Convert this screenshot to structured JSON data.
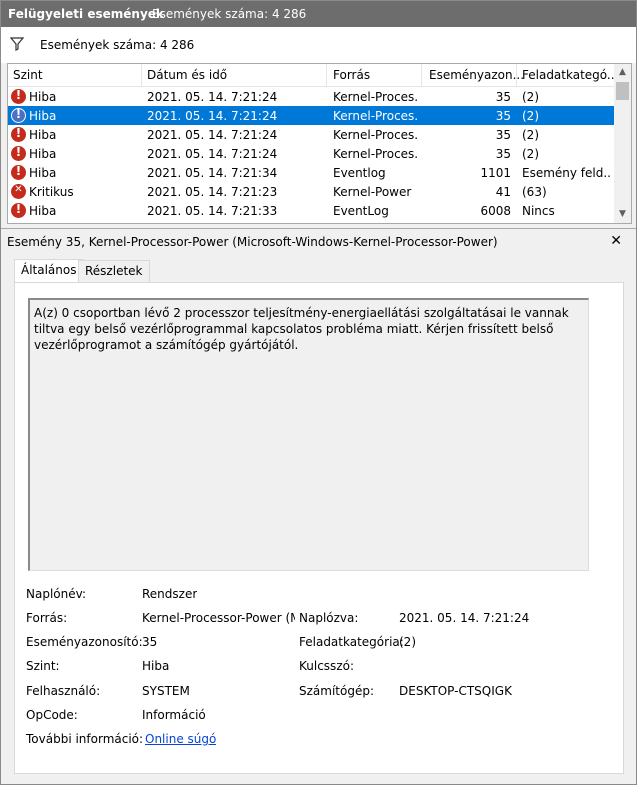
{
  "titlebar": {
    "title": "Felügyeleti események",
    "count": "Események száma: 4 286"
  },
  "filter": {
    "text": "Események száma: 4 286"
  },
  "grid": {
    "columns": [
      "Szint",
      "Dátum és idő",
      "Forrás",
      "Eseményazon...",
      "Feladatkategó..."
    ],
    "rows": [
      {
        "level": "Hiba",
        "date": "2021. 05. 14. 7:21:24",
        "source": "Kernel-Proces...",
        "id": "35",
        "task": "(2)",
        "icon": "error-icon"
      },
      {
        "level": "Hiba",
        "date": "2021. 05. 14. 7:21:24",
        "source": "Kernel-Proces...",
        "id": "35",
        "task": "(2)",
        "icon": "error-icon"
      },
      {
        "level": "Hiba",
        "date": "2021. 05. 14. 7:21:24",
        "source": "Kernel-Proces...",
        "id": "35",
        "task": "(2)",
        "icon": "error-icon"
      },
      {
        "level": "Hiba",
        "date": "2021. 05. 14. 7:21:24",
        "source": "Kernel-Proces...",
        "id": "35",
        "task": "(2)",
        "icon": "error-icon"
      },
      {
        "level": "Hiba",
        "date": "2021. 05. 14. 7:21:34",
        "source": "Eventlog",
        "id": "1101",
        "task": "Esemény feld...",
        "icon": "error-icon"
      },
      {
        "level": "Kritikus",
        "date": "2021. 05. 14. 7:21:23",
        "source": "Kernel-Power",
        "id": "41",
        "task": "(63)",
        "icon": "critical-icon"
      },
      {
        "level": "Hiba",
        "date": "2021. 05. 14. 7:21:33",
        "source": "EventLog",
        "id": "6008",
        "task": "Nincs",
        "icon": "error-icon"
      }
    ],
    "selected_index": 1
  },
  "detail": {
    "header": "Esemény 35, Kernel-Processor-Power (Microsoft-Windows-Kernel-Processor-Power)",
    "tabs": [
      "Általános",
      "Részletek"
    ],
    "description": "A(z) 0 csoportban lévő 2 processzor teljesítmény-energiaellátási szolgáltatásai le vannak tiltva egy belső vezérlőprogrammal kapcsolatos probléma miatt. Kérjen frissített belső vezérlőprogramot a számítógép gyártójától.",
    "fields": {
      "log_name_label": "Naplónév:",
      "log_name": "Rendszer",
      "source_label": "Forrás:",
      "source": "Kernel-Processor-Power (Mi",
      "logged_label": "Naplózva:",
      "logged": "2021. 05. 14. 7:21:24",
      "event_id_label": "Eseményazonosító:",
      "event_id": "35",
      "task_label": "Feladatkategória:",
      "task": "(2)",
      "level_label": "Szint:",
      "level": "Hiba",
      "keywords_label": "Kulcsszó:",
      "keywords": "",
      "user_label": "Felhasználó:",
      "user": "SYSTEM",
      "computer_label": "Számítógép:",
      "computer": "DESKTOP-CTSQIGK",
      "opcode_label": "OpCode:",
      "opcode": "Információ",
      "more_info_label": "További információ:",
      "more_info": "Online súgó"
    }
  },
  "colors": {
    "accent": "#0078d7",
    "titlebar": "#6d6d6d",
    "error": "#c42b1c",
    "link": "#0645d8"
  }
}
